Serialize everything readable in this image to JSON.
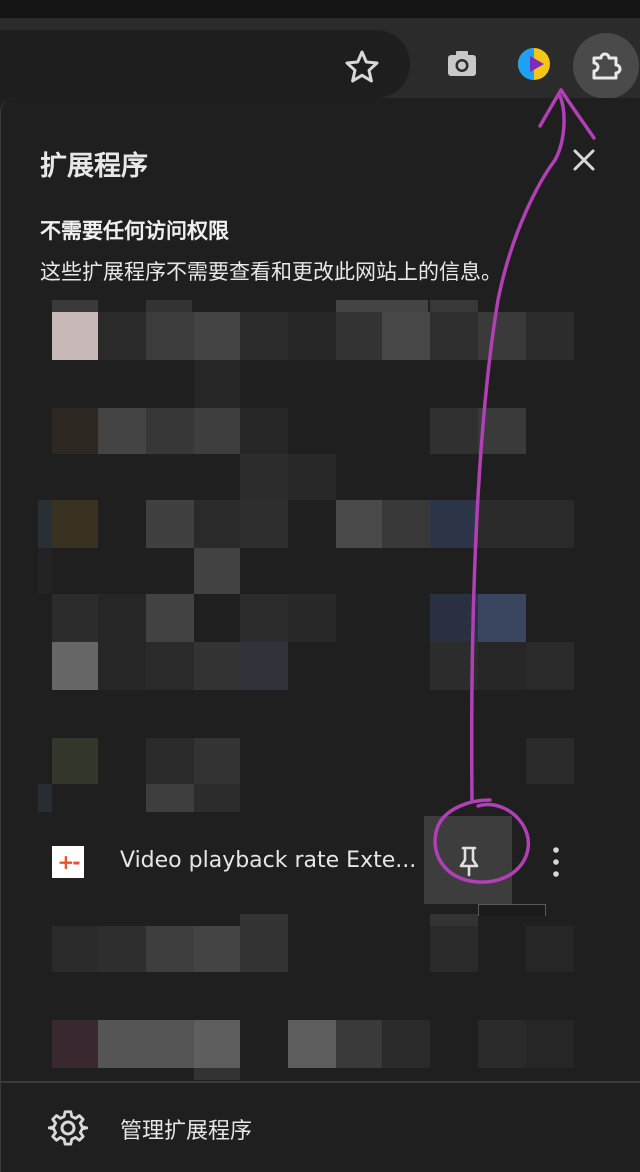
{
  "panel": {
    "title": "扩展程序",
    "close_icon": "close-icon"
  },
  "section": {
    "title": "不需要任何访问权限",
    "description": "这些扩展程序不需要查看和更改此网站上的信息。"
  },
  "extension": {
    "icon_text": "+-",
    "name": "Video playback rate Exte...",
    "pin_icon": "pin-icon",
    "more_icon": "more-vert-icon"
  },
  "footer": {
    "manage_label": "管理扩展程序",
    "icon": "gear-icon"
  },
  "toolbar": {
    "icons": [
      "star-icon",
      "camera-icon",
      "colorful-extension-icon",
      "puzzle-icon"
    ]
  },
  "colors": {
    "background": "#1f1f1f",
    "toolbar": "#2b2b2b",
    "annotation": "#b13fb5",
    "ext_icon_orange": "#e8542a"
  }
}
